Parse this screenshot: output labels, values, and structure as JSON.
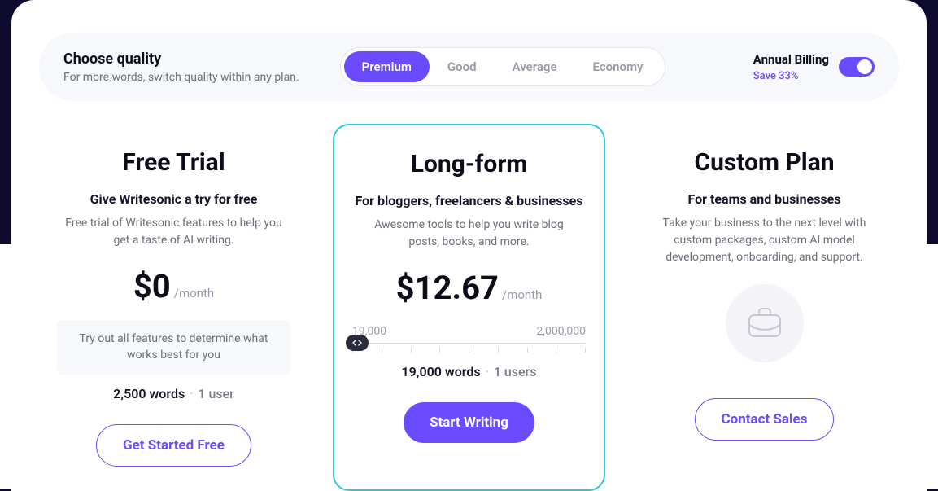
{
  "quality": {
    "title": "Choose quality",
    "subtitle": "For more words, switch quality within any plan."
  },
  "segmented": {
    "options": [
      "Premium",
      "Good",
      "Average",
      "Economy"
    ],
    "active_index": 0
  },
  "billing": {
    "title": "Annual Billing",
    "save": "Save 33%",
    "toggle_on": true
  },
  "plans": {
    "free": {
      "name": "Free Trial",
      "subtitle": "Give Writesonic a try for free",
      "desc": "Free trial of Writesonic features to help you get a taste of AI writing.",
      "price": "$0",
      "per": "/month",
      "note": "Try out all features to determine what works best for you",
      "words": "2,500 words",
      "users": "1 user",
      "cta": "Get Started Free"
    },
    "long": {
      "name": "Long-form",
      "subtitle": "For bloggers, freelancers & businesses",
      "desc": "Awesome tools to help you write blog posts, books, and more.",
      "price": "$12.67",
      "per": "/month",
      "slider_min": "19,000",
      "slider_max": "2,000,000",
      "words": "19,000 words",
      "users": "1 users",
      "cta": "Start Writing"
    },
    "custom": {
      "name": "Custom Plan",
      "subtitle": "For teams and businesses",
      "desc": "Take your business to the next level with custom packages, custom AI model development, onboarding, and support.",
      "cta": "Contact Sales"
    }
  }
}
